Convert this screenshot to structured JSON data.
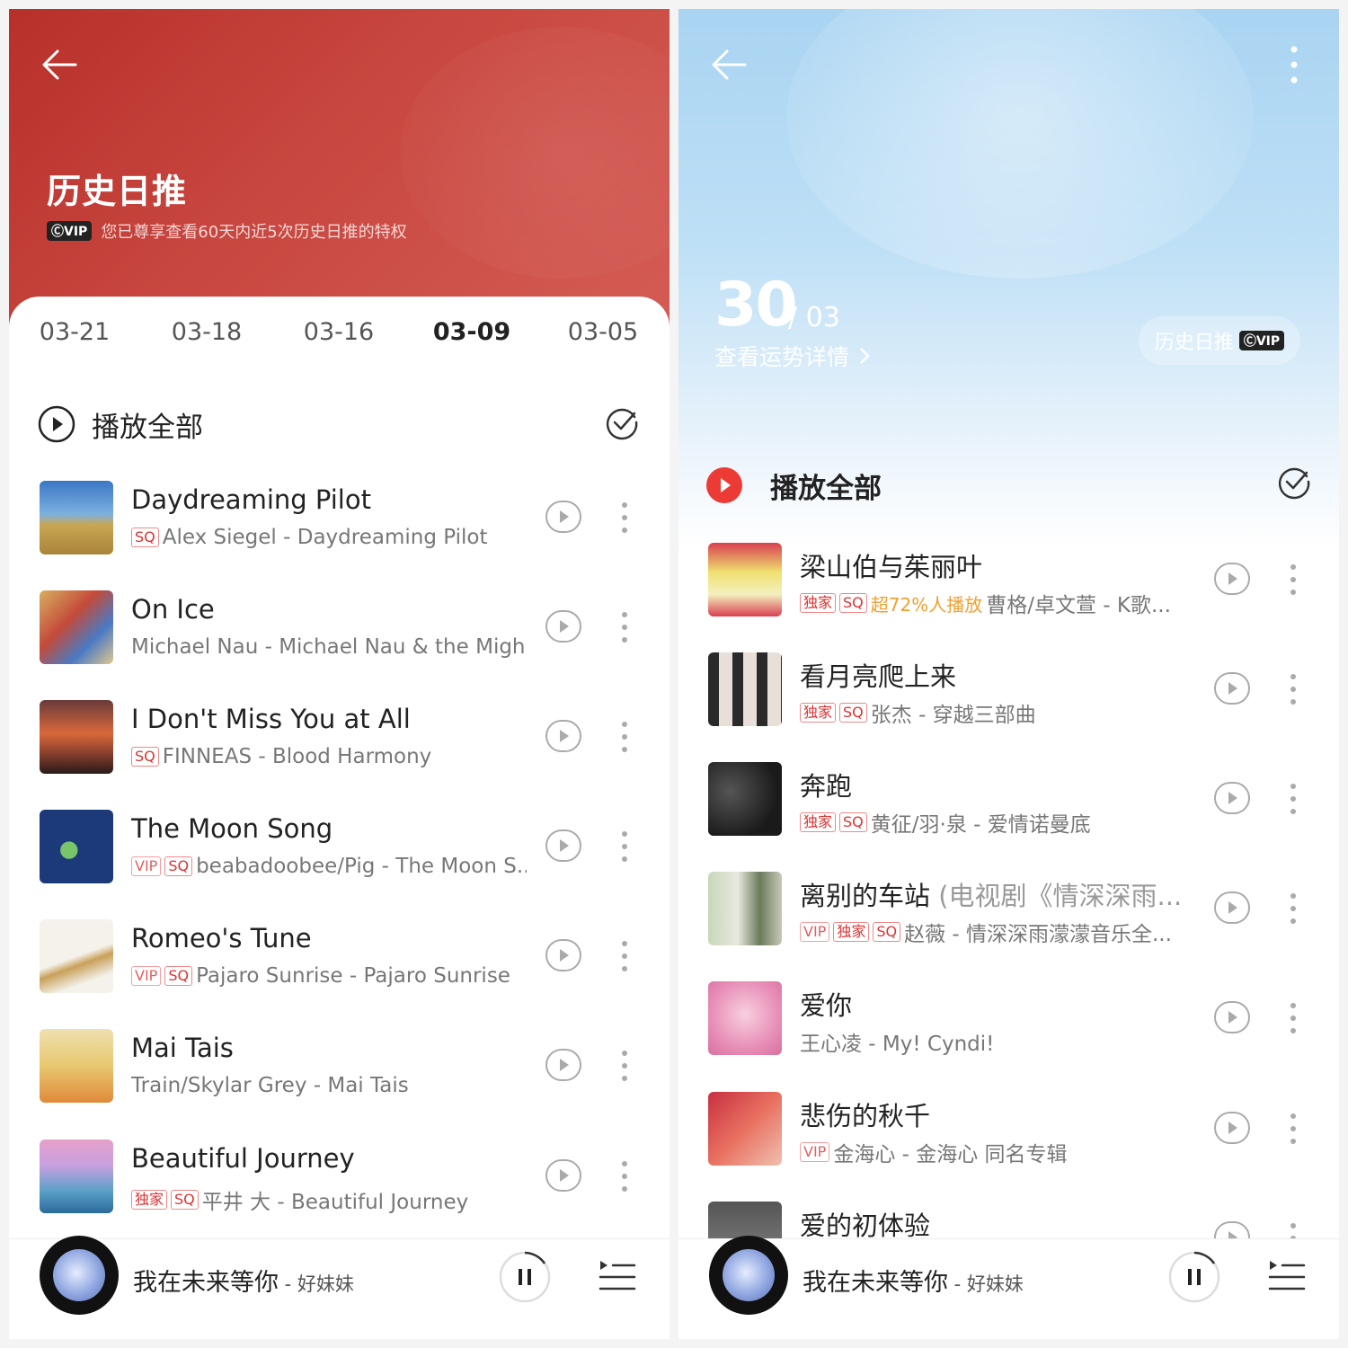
{
  "left": {
    "title": "历史日推",
    "vip_badge": "ⒸVIP",
    "subtitle": "您已尊享查看60天内近5次历史日推的特权",
    "tabs": [
      "03-21",
      "03-18",
      "03-16",
      "03-09",
      "03-05"
    ],
    "active_tab": "03-09",
    "play_all": "播放全部",
    "songs": [
      {
        "title": "Daydreaming Pilot",
        "tags": [
          "SQ"
        ],
        "meta": "Alex Siegel - Daydreaming Pilot"
      },
      {
        "title": "On Ice",
        "tags": [],
        "meta": "Michael Nau - Michael Nau & the Migh..."
      },
      {
        "title": "I Don't Miss You at All",
        "tags": [
          "SQ"
        ],
        "meta": "FINNEAS - Blood Harmony"
      },
      {
        "title": "The Moon Song",
        "tags": [
          "VIP",
          "SQ"
        ],
        "meta": "beabadoobee/Pig - The Moon S..."
      },
      {
        "title": "Romeo's Tune",
        "tags": [
          "VIP",
          "SQ"
        ],
        "meta": "Pajaro Sunrise - Pajaro Sunrise"
      },
      {
        "title": "Mai Tais",
        "tags": [],
        "meta": "Train/Skylar Grey - Mai Tais"
      },
      {
        "title": "Beautiful Journey",
        "tags": [
          "独家",
          "SQ"
        ],
        "meta": "平井 大 - Beautiful Journey"
      }
    ],
    "now_playing": {
      "title": "我在未来等你",
      "artist": " - 好妹妹"
    }
  },
  "right": {
    "day": "30",
    "month": "/ 03",
    "fortune": "查看运势详情",
    "history_button": "历史日推",
    "vip_badge": "ⒸVIP",
    "play_all": "播放全部",
    "songs": [
      {
        "title": "梁山伯与茱丽叶",
        "tags": [
          "独家",
          "SQ"
        ],
        "hot": "超72%人播放",
        "meta": "曹格/卓文萱 - K歌..."
      },
      {
        "title": "看月亮爬上来",
        "tags": [
          "独家",
          "SQ"
        ],
        "hot": "",
        "meta": "张杰 - 穿越三部曲"
      },
      {
        "title": "奔跑",
        "tags": [
          "独家",
          "SQ"
        ],
        "hot": "",
        "meta": "黄征/羽·泉 - 爱情诺曼底"
      },
      {
        "title": "离别的车站",
        "title_suffix": " (电视剧《情深深雨...",
        "tags": [
          "VIP",
          "独家",
          "SQ"
        ],
        "hot": "",
        "meta": "赵薇 - 情深深雨濛濛音乐全..."
      },
      {
        "title": "爱你",
        "tags": [],
        "hot": "",
        "meta": "王心凌 - My! Cyndi!"
      },
      {
        "title": "悲伤的秋千",
        "tags": [
          "VIP"
        ],
        "hot": "",
        "meta": "金海心 - 金海心 同名专辑"
      },
      {
        "title": "爱的初体验",
        "tags": [],
        "hot": "",
        "meta": ""
      }
    ],
    "now_playing": {
      "title": "我在未来等你",
      "artist": " - 好妹妹"
    }
  },
  "colors": {
    "accent": "#e8434a",
    "left_header": "#c4413b",
    "right_header": "#b4daf4"
  }
}
